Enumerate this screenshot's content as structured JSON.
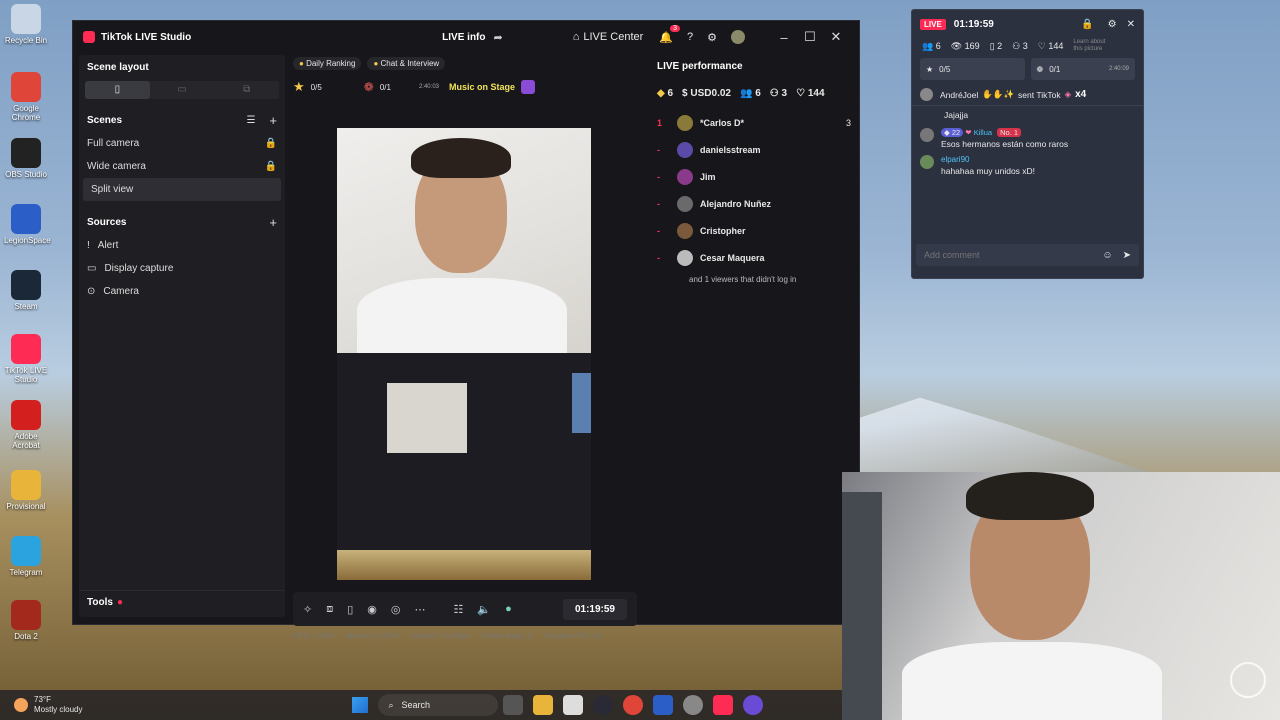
{
  "desktop": {
    "icons": [
      {
        "label": "Recycle Bin",
        "color": "#c8d6e5"
      },
      {
        "label": "Google Chrome",
        "color": "#e0453a"
      },
      {
        "label": "OBS Studio",
        "color": "#222"
      },
      {
        "label": "LegionSpace",
        "color": "#2b5fc7"
      },
      {
        "label": "Steam",
        "color": "#1b2838"
      },
      {
        "label": "TikTok LIVE Studio",
        "color": "#fe2c55"
      },
      {
        "label": "Adobe Acrobat",
        "color": "#d41f1f"
      },
      {
        "label": "Provisional",
        "color": "#e8b53a"
      },
      {
        "label": "Telegram",
        "color": "#2aa3df"
      },
      {
        "label": "Dota 2",
        "color": "#a3291c"
      }
    ]
  },
  "app": {
    "title": "TikTok LIVE Studio",
    "live_info": "LIVE info",
    "live_center": "LIVE Center",
    "notif_count": "3",
    "scene_layout": "Scene layout",
    "scenes_header": "Scenes",
    "scenes": [
      "Full camera",
      "Wide camera",
      "Split view"
    ],
    "sources_header": "Sources",
    "sources": [
      "Alert",
      "Display capture",
      "Camera"
    ],
    "tools": "Tools",
    "tab_daily": "Daily Ranking",
    "tab_chat": "Chat & Interview",
    "goal1": "0/5",
    "goal2": "0/1",
    "goal2_time": "2:40:03",
    "music": "Music on Stage",
    "timer": "01:19:59",
    "status": {
      "cpu": "CPU: 0.38%",
      "memory": "Memory: 0.52%",
      "upload": "Upload: 3.6 Mbps",
      "drops": "Frame drops: 0",
      "fps": "Encoder FPS: 30"
    },
    "perf_header": "LIVE performance",
    "stats": {
      "diamonds": "6",
      "usd": "USD0.02",
      "viewers": "6",
      "followers": "3",
      "likes": "144"
    },
    "viewers": [
      {
        "rank": "1",
        "name": "*Carlos D*",
        "score": "3",
        "color": "#8a7a3a"
      },
      {
        "rank": "-",
        "name": "danielsstream",
        "score": "",
        "color": "#5c4aa8"
      },
      {
        "rank": "-",
        "name": "Jim",
        "score": "",
        "color": "#8a3a8a"
      },
      {
        "rank": "-",
        "name": "Alejandro Nuñez",
        "score": "",
        "color": "#6a6a6a"
      },
      {
        "rank": "-",
        "name": "Cristopher",
        "score": "",
        "color": "#7a5a3a"
      },
      {
        "rank": "-",
        "name": "Cesar Maquera",
        "score": "",
        "color": "#bbbbbb"
      }
    ],
    "viewers_note": "and 1 viewers that didn't log in"
  },
  "chat": {
    "live_badge": "LIVE",
    "time": "01:19:59",
    "stats": {
      "viewers": "6",
      "views": "169",
      "shares": "2",
      "followers": "3",
      "likes": "144"
    },
    "goal1": "0/5",
    "goal2": "0/1",
    "goal2_time": "2:40:09",
    "gift_user": "AndréJoel",
    "gift_text": "sent TikTok",
    "gift_count": "x4",
    "messages": [
      {
        "user": "",
        "level": "",
        "text": "Jajajja"
      },
      {
        "user": "Killua",
        "level": "22",
        "badge": "No. 1",
        "text": "Esos hermanos están como raros"
      },
      {
        "user": "elpari90",
        "level": "",
        "text": "hahahaa muy unidos xD!"
      }
    ],
    "placeholder": "Add comment",
    "learn": "Learn about this picture"
  },
  "taskbar": {
    "weather_temp": "73°F",
    "weather_desc": "Mostly cloudy",
    "search": "Search"
  }
}
